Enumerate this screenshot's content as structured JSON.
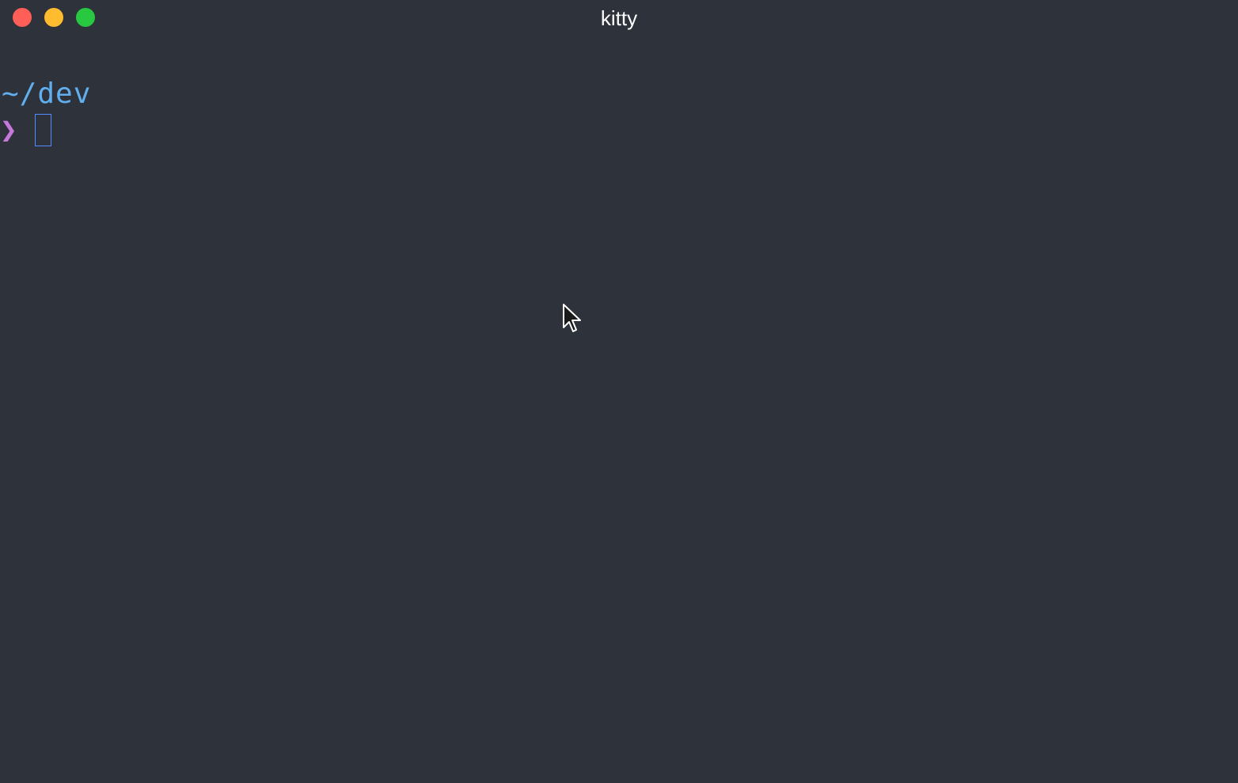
{
  "window": {
    "title": "kitty",
    "background": "#2e323b"
  },
  "traffic_lights": {
    "close_color": "#ff5f57",
    "minimize_color": "#febc2e",
    "zoom_color": "#28c840"
  },
  "terminal": {
    "cwd": "~/dev",
    "cwd_color": "#61afef",
    "prompt_symbol": "❯",
    "prompt_color": "#c678dd",
    "input_value": "",
    "cursor_color": "#528bff"
  },
  "icons": {
    "close": "close-icon",
    "minimize": "minimize-icon",
    "zoom": "zoom-icon",
    "mouse_pointer": "mouse-pointer-icon"
  }
}
